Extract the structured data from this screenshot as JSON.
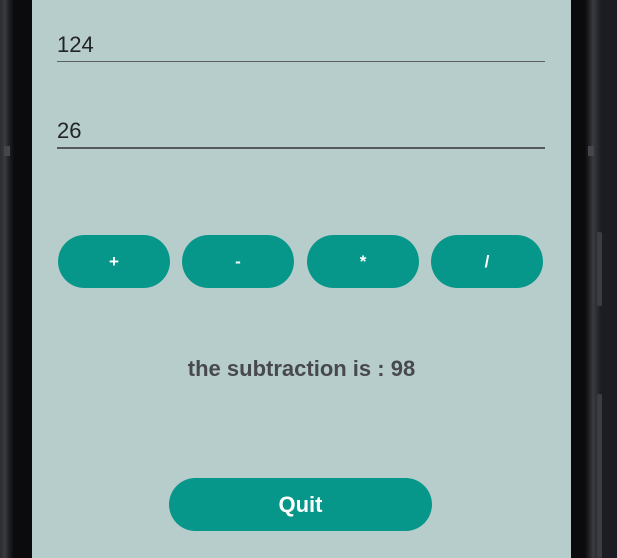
{
  "inputs": {
    "first_value": "124",
    "second_value": "26"
  },
  "operations": {
    "add_label": "+",
    "subtract_label": "-",
    "multiply_label": "*",
    "divide_label": "/"
  },
  "result": {
    "text": "the subtraction is : 98"
  },
  "actions": {
    "quit_label": "Quit"
  },
  "colors": {
    "screen_background": "#b6cdcb",
    "accent": "#07978a",
    "result_text": "#48494f"
  }
}
